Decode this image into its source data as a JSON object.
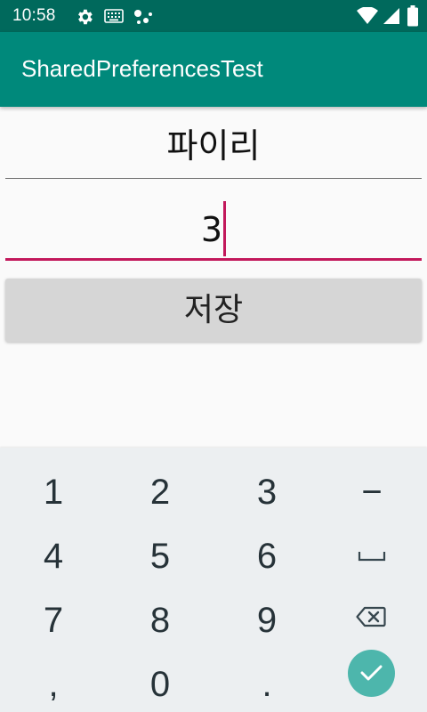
{
  "status_bar": {
    "time": "10:58",
    "icons": [
      "gear-icon",
      "keyboard-icon",
      "assistant-dots-icon",
      "wifi-icon",
      "cell-signal-icon",
      "battery-icon"
    ]
  },
  "app_bar": {
    "title": "SharedPreferencesTest"
  },
  "form": {
    "name_value": "파이리",
    "count_value": "3",
    "save_label": "저장"
  },
  "keyboard": {
    "rows": [
      [
        "1",
        "2",
        "3",
        "−"
      ],
      [
        "4",
        "5",
        "6",
        "space-icon"
      ],
      [
        "7",
        "8",
        "9",
        "backspace-icon"
      ],
      [
        ",",
        "0",
        ".",
        "enter-check-icon"
      ]
    ],
    "labels": {
      "k1": "1",
      "k2": "2",
      "k3": "3",
      "minus": "−",
      "k4": "4",
      "k5": "5",
      "k6": "6",
      "k7": "7",
      "k8": "8",
      "k9": "9",
      "comma": ",",
      "k0": "0",
      "period": "."
    }
  },
  "colors": {
    "status_bar": "#00695c",
    "app_bar": "#00897b",
    "accent": "#c2185b",
    "enter_key": "#4db6ac",
    "keyboard_bg": "#eceff1"
  }
}
